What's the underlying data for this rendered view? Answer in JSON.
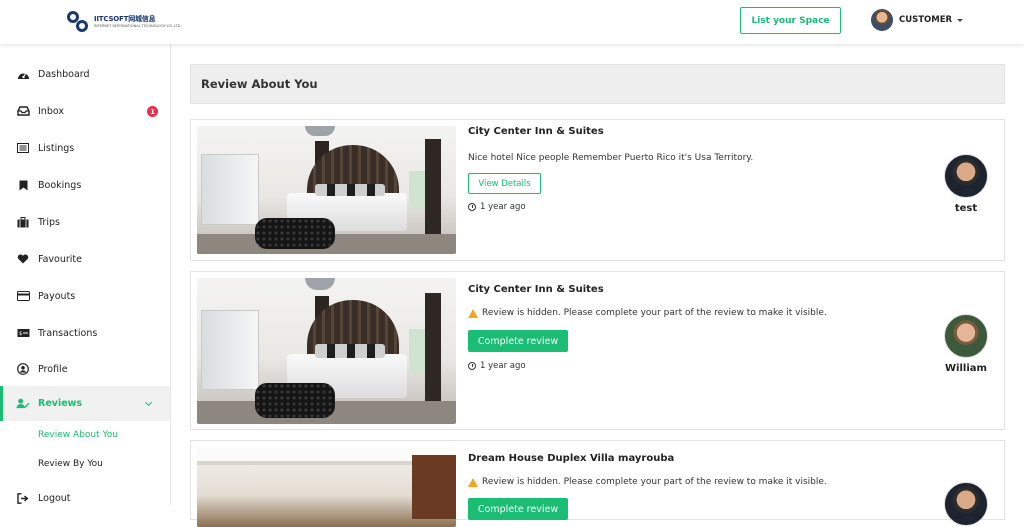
{
  "header": {
    "logo_text": "IITCSOFT网城信息",
    "logo_subtext": "INTERNET INTERNATIONAL TECHNOLOGY CO.,LTD",
    "list_space_label": "List your Space",
    "user_name": "CUSTOMER"
  },
  "sidebar": {
    "items": [
      {
        "label": "Dashboard",
        "icon": "dashboard-icon"
      },
      {
        "label": "Inbox",
        "icon": "inbox-icon",
        "badge": "1"
      },
      {
        "label": "Listings",
        "icon": "list-icon"
      },
      {
        "label": "Bookings",
        "icon": "bookmark-icon"
      },
      {
        "label": "Trips",
        "icon": "suitcase-icon"
      },
      {
        "label": "Favourite",
        "icon": "heart-icon"
      },
      {
        "label": "Payouts",
        "icon": "card-icon"
      },
      {
        "label": "Transactions",
        "icon": "money-icon"
      },
      {
        "label": "Profile",
        "icon": "user-circle-icon"
      },
      {
        "label": "Reviews",
        "icon": "user-edit-icon"
      }
    ],
    "sub_items": [
      {
        "label": "Review About You"
      },
      {
        "label": "Review By You"
      }
    ],
    "logout_label": "Logout"
  },
  "main": {
    "title": "Review About You",
    "reviews": [
      {
        "listing": "City Center Inn & Suites",
        "text": "Nice hotel Nice people Remember Puerto Rico it's Usa Territory.",
        "action": "View Details",
        "time": "1 year ago",
        "reviewer": "test"
      },
      {
        "listing": "City Center Inn & Suites",
        "text": "Review is hidden. Please complete your part of the review to make it visible.",
        "action": "Complete review",
        "time": "1 year ago",
        "reviewer": "William"
      },
      {
        "listing": "Dream House Duplex Villa mayrouba",
        "text": "Review is hidden. Please complete your part of the review to make it visible.",
        "action": "Complete review",
        "time": "",
        "reviewer": ""
      }
    ]
  },
  "colors": {
    "accent": "#1bbc74",
    "badge": "#e8304a",
    "warning": "#f1a81d"
  }
}
